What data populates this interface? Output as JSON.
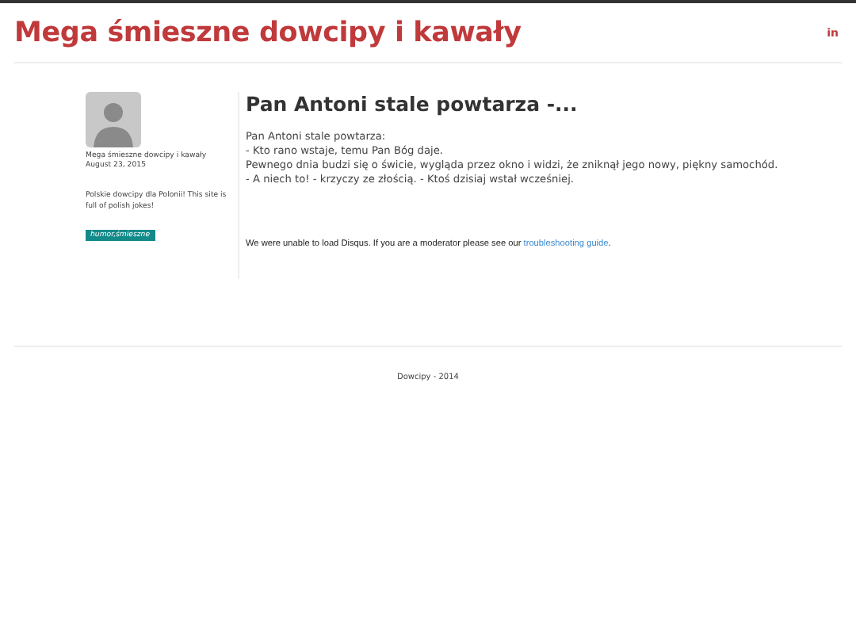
{
  "header": {
    "title": "Mega śmieszne dowcipy i kawały",
    "social": "in"
  },
  "sidebar": {
    "author": "Mega śmieszne dowcipy i kawały",
    "date": "August 23, 2015",
    "description": "Polskie dowcipy dla Polonii! This site is full of polish jokes!",
    "tags": [
      "humor,śmieszne"
    ]
  },
  "post": {
    "title": "Pan Antoni stale powtarza -...",
    "lines": [
      "Pan Antoni stale powtarza:",
      "- Kto rano wstaje, temu Pan Bóg daje.",
      "Pewnego dnia budzi się o świcie, wygląda przez okno i widzi, że zniknął jego nowy, piękny samochód.",
      "- A niech to! - krzyczy ze złością. - Ktoś dzisiaj wstał wcześniej."
    ]
  },
  "comments": {
    "message": "We were unable to load Disqus. If you are a moderator please see our ",
    "link": "troubleshooting guide",
    "end": "."
  },
  "footer": {
    "text": "Dowcipy - 2014"
  }
}
